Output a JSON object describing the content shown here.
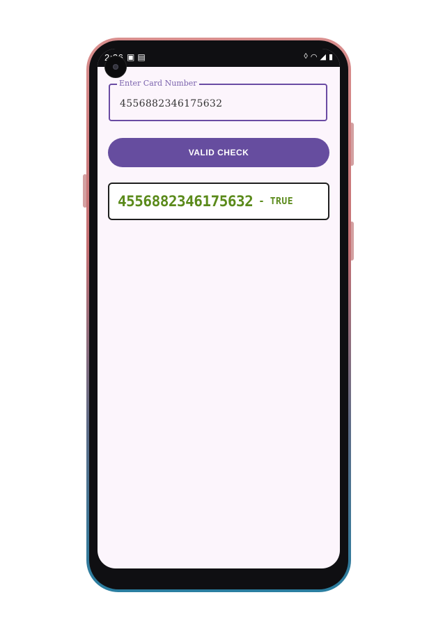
{
  "status_bar": {
    "time": "2:36",
    "left_icons": [
      "image-icon",
      "calendar-icon"
    ],
    "right_icons": [
      "mute-icon",
      "wifi-icon",
      "signal-icon",
      "battery-icon"
    ]
  },
  "card_input": {
    "label": "Enter Card Number",
    "value": "4556882346175632"
  },
  "valid_button": {
    "label": "VALID CHECK"
  },
  "result": {
    "number": "4556882346175632",
    "separator": "-",
    "status": "TRUE"
  },
  "colors": {
    "accent": "#664d9f",
    "field_border": "#6a4ba3",
    "result_text": "#5a8a1a",
    "screen_bg": "#fcf5fc"
  }
}
